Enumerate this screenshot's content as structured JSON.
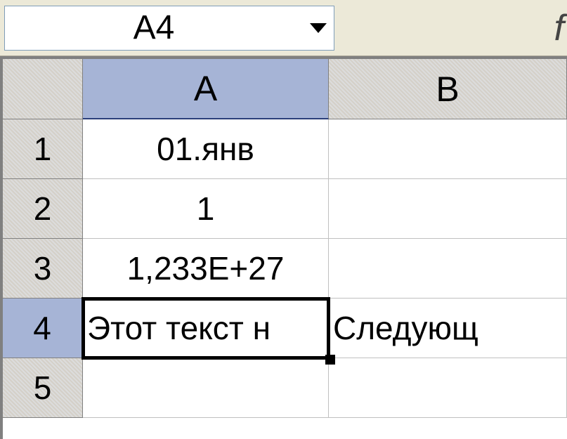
{
  "namebox": {
    "value": "A4"
  },
  "formula_bar": {
    "fx_label": "f"
  },
  "columns": [
    {
      "id": "A",
      "label": "A",
      "active": true
    },
    {
      "id": "B",
      "label": "B",
      "active": false
    }
  ],
  "rows": [
    {
      "num": "1",
      "active": false,
      "cells": {
        "A": "01.янв",
        "B": ""
      },
      "align": {
        "A": "center",
        "B": "left"
      }
    },
    {
      "num": "2",
      "active": false,
      "cells": {
        "A": "1",
        "B": ""
      },
      "align": {
        "A": "center",
        "B": "left"
      }
    },
    {
      "num": "3",
      "active": false,
      "cells": {
        "A": "1,233E+27",
        "B": ""
      },
      "align": {
        "A": "center",
        "B": "left"
      }
    },
    {
      "num": "4",
      "active": true,
      "cells": {
        "A": "Этот текст н",
        "B": "Следующ"
      },
      "align": {
        "A": "left",
        "B": "left"
      }
    },
    {
      "num": "5",
      "active": false,
      "cells": {
        "A": "",
        "B": ""
      },
      "align": {
        "A": "left",
        "B": "left"
      }
    }
  ],
  "selection": {
    "cell": "A4"
  }
}
